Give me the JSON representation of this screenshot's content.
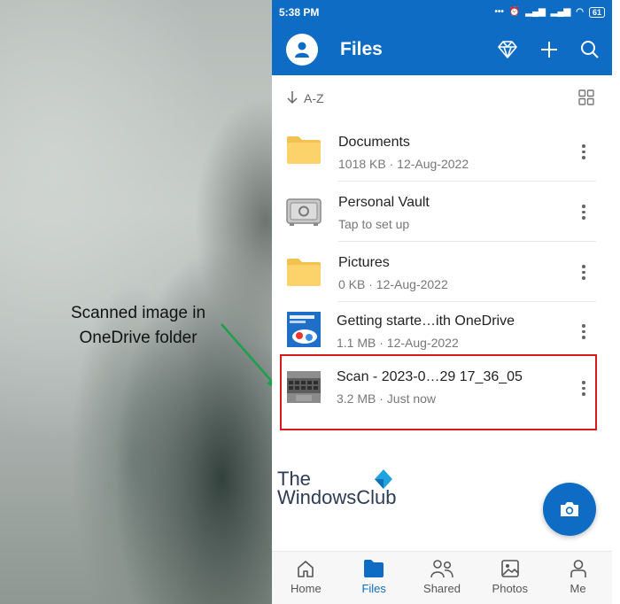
{
  "annotation": {
    "text_line1": "Scanned image in",
    "text_line2": "OneDrive folder"
  },
  "status_bar": {
    "time": "5:38 PM",
    "battery": "61"
  },
  "app_bar": {
    "title": "Files"
  },
  "sort": {
    "label": "A-Z"
  },
  "files": [
    {
      "name": "Documents",
      "meta": "1018 KB · 12-Aug-2022",
      "icon": "folder-icon"
    },
    {
      "name": "Personal Vault",
      "meta": "Tap to set up",
      "icon": "vault-icon"
    },
    {
      "name": "Pictures",
      "meta": "0 KB · 12-Aug-2022",
      "icon": "folder-icon"
    },
    {
      "name": "Getting starte…ith OneDrive",
      "meta": "1.1 MB · 12-Aug-2022",
      "icon": "pdf-thumbnail"
    },
    {
      "name": "Scan - 2023-0…29 17_36_05",
      "meta": "3.2 MB · Just now",
      "icon": "scan-thumbnail"
    }
  ],
  "watermark": {
    "line1": "The",
    "line2": "WindowsClub"
  },
  "bottom_nav": [
    {
      "label": "Home",
      "icon": "home-icon"
    },
    {
      "label": "Files",
      "icon": "folder-icon",
      "active": true
    },
    {
      "label": "Shared",
      "icon": "people-icon"
    },
    {
      "label": "Photos",
      "icon": "photo-icon"
    },
    {
      "label": "Me",
      "icon": "person-icon"
    }
  ],
  "colors": {
    "brand": "#0f6cc5",
    "highlight": "#d9191e",
    "arrow": "#1aa14a",
    "folder": "#fbd36a"
  }
}
